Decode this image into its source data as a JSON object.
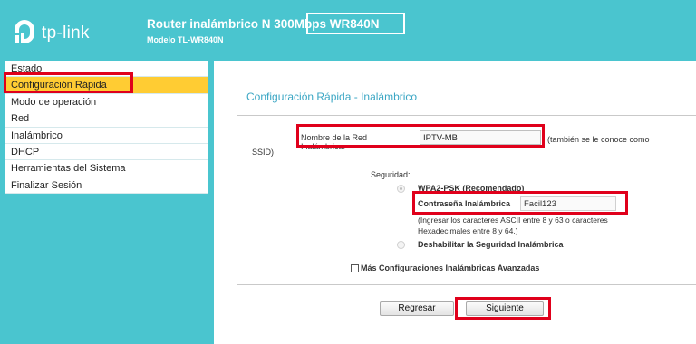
{
  "header": {
    "logo_text": "tp-link",
    "router_title": "Router inalámbrico N 300Mbps WR840N",
    "model": "Modelo TL-WR840N"
  },
  "sidebar": {
    "items": [
      {
        "label": "Estado",
        "active": false
      },
      {
        "label": "Configuración Rápida",
        "active": true
      },
      {
        "label": "Modo de operación",
        "active": false
      },
      {
        "label": "Red",
        "active": false
      },
      {
        "label": "Inalámbrico",
        "active": false
      },
      {
        "label": "DHCP",
        "active": false
      },
      {
        "label": "Herramientas del Sistema",
        "active": false
      },
      {
        "label": "Finalizar Sesión",
        "active": false
      }
    ]
  },
  "main": {
    "title": "Configuración Rápida - Inalámbrico",
    "ssid_label": "Nombre de la Red Inalámbrica:",
    "ssid_value": "IPTV-MB",
    "ssid_note": "(también se le conoce como",
    "ssid_note2": "SSID)",
    "security_label": "Seguridad:",
    "wpa_option": "WPA2-PSK (Recomendado)",
    "password_label": "Contraseña Inalámbrica",
    "password_value": "Facil123",
    "password_hint1": "(Ingresar los caracteres ASCII entre 8 y 63 o caracteres",
    "password_hint2": "Hexadecimales entre 8 y 64.)",
    "disable_option": "Deshabilitar la Seguridad Inalámbrica",
    "advanced_label": "Más Configuraciones Inalámbricas Avanzadas",
    "back_button": "Regresar",
    "next_button": "Siguiente"
  },
  "colors": {
    "header_bg": "#4ac5cf",
    "active_menu": "#ffcc33",
    "title": "#3aa6c4",
    "highlight_box": "#e0001b"
  }
}
